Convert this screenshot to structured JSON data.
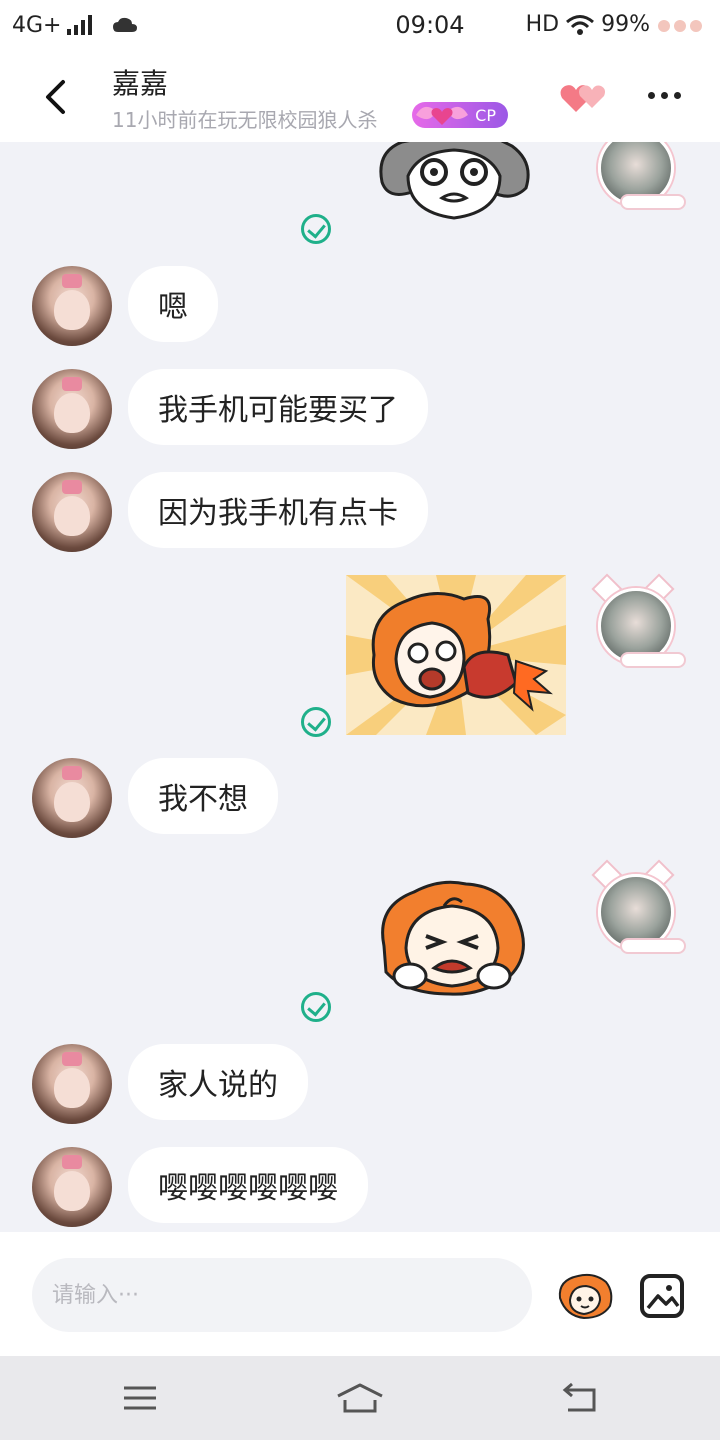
{
  "status_bar": {
    "network": "4G+",
    "time": "09:04",
    "hd": "HD",
    "battery": "99%"
  },
  "header": {
    "contact_name": "嘉嘉",
    "contact_status": "11小时前在玩无限校园狼人杀",
    "cp_badge": "CP"
  },
  "messages": [
    {
      "side": "me",
      "type": "sticker",
      "sticker": "grey-shocked-face-sticker",
      "read": true
    },
    {
      "side": "them",
      "type": "text",
      "text": "嗯"
    },
    {
      "side": "them",
      "type": "text",
      "text": "我手机可能要买了"
    },
    {
      "side": "them",
      "type": "text",
      "text": "因为我手机有点卡"
    },
    {
      "side": "me",
      "type": "sticker",
      "sticker": "punch-glove-sticker",
      "read": true
    },
    {
      "side": "them",
      "type": "text",
      "text": "我不想"
    },
    {
      "side": "me",
      "type": "sticker",
      "sticker": "crying-sticker",
      "read": true
    },
    {
      "side": "them",
      "type": "text",
      "text": "家人说的"
    },
    {
      "side": "them",
      "type": "text",
      "text": "嘤嘤嘤嘤嘤嘤"
    }
  ],
  "input": {
    "placeholder": "请输入···"
  },
  "colors": {
    "chat_background": "#f1f2f7",
    "read_check": "#1fb08a",
    "cp_badge": "#b25fe8"
  }
}
